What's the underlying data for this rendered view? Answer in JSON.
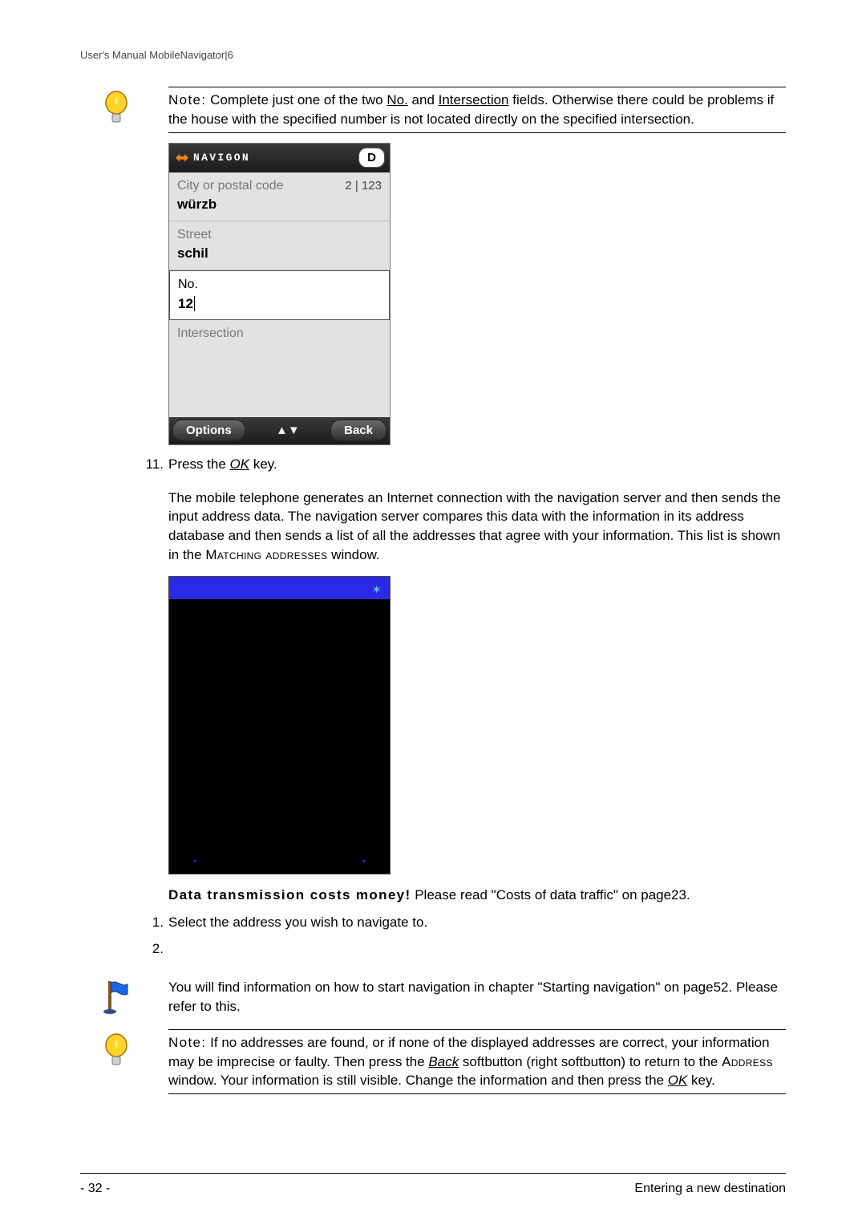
{
  "header": "User's Manual MobileNavigator|6",
  "note1": {
    "lead": "Note:",
    "body1": " Complete just one of the two ",
    "no": "No.",
    "and": " and ",
    "intersection": "Intersection",
    "body2": " fields. Otherwise there could be problems if the house with the specified number is not located directly on the specified intersection."
  },
  "phone": {
    "brand": "NAVIGON",
    "country": "D",
    "city_label": "City or postal code",
    "city_meta": "2 | 123",
    "city_value": "würzb",
    "street_label": "Street",
    "street_value": "schil",
    "no_label": "No.",
    "no_value": "12",
    "intersection_label": "Intersection",
    "soft_left": "Options",
    "soft_right": "Back"
  },
  "step11_num": "11.",
  "step11_a": "Press the ",
  "step11_ok": "OK",
  "step11_b": " key.",
  "para_server": {
    "a": "The mobile telephone generates an Internet connection with the navigation server and then sends the input address data. The navigation server compares this data with the information in its address database and then sends a list of all the addresses that agree with your information. This list is shown in the ",
    "b": "Matching addresses",
    "c": " window."
  },
  "cost": {
    "lead": "Data transmission costs money!",
    "body": " Please read \"Costs of data traffic\" on page23."
  },
  "step1_num": "1.",
  "step1": "Select the address you wish to navigate to.",
  "step2_num": "2.",
  "flag_para": "You will find information on how to start navigation in chapter \"Starting navigation\" on page52. Please refer to this.",
  "note2": {
    "lead": "Note:",
    "a": " If no addresses are found, or if none of the displayed addresses are correct, your information may be imprecise or faulty. Then press the ",
    "back": "Back",
    "b": " softbutton (right softbutton) to return to the ",
    "addr": "Address",
    "c": " window. Your information is still visible. Change the information and then press the ",
    "ok": "OK",
    "d": " key."
  },
  "footer_left": "- 32 -",
  "footer_right": "Entering a new destination"
}
